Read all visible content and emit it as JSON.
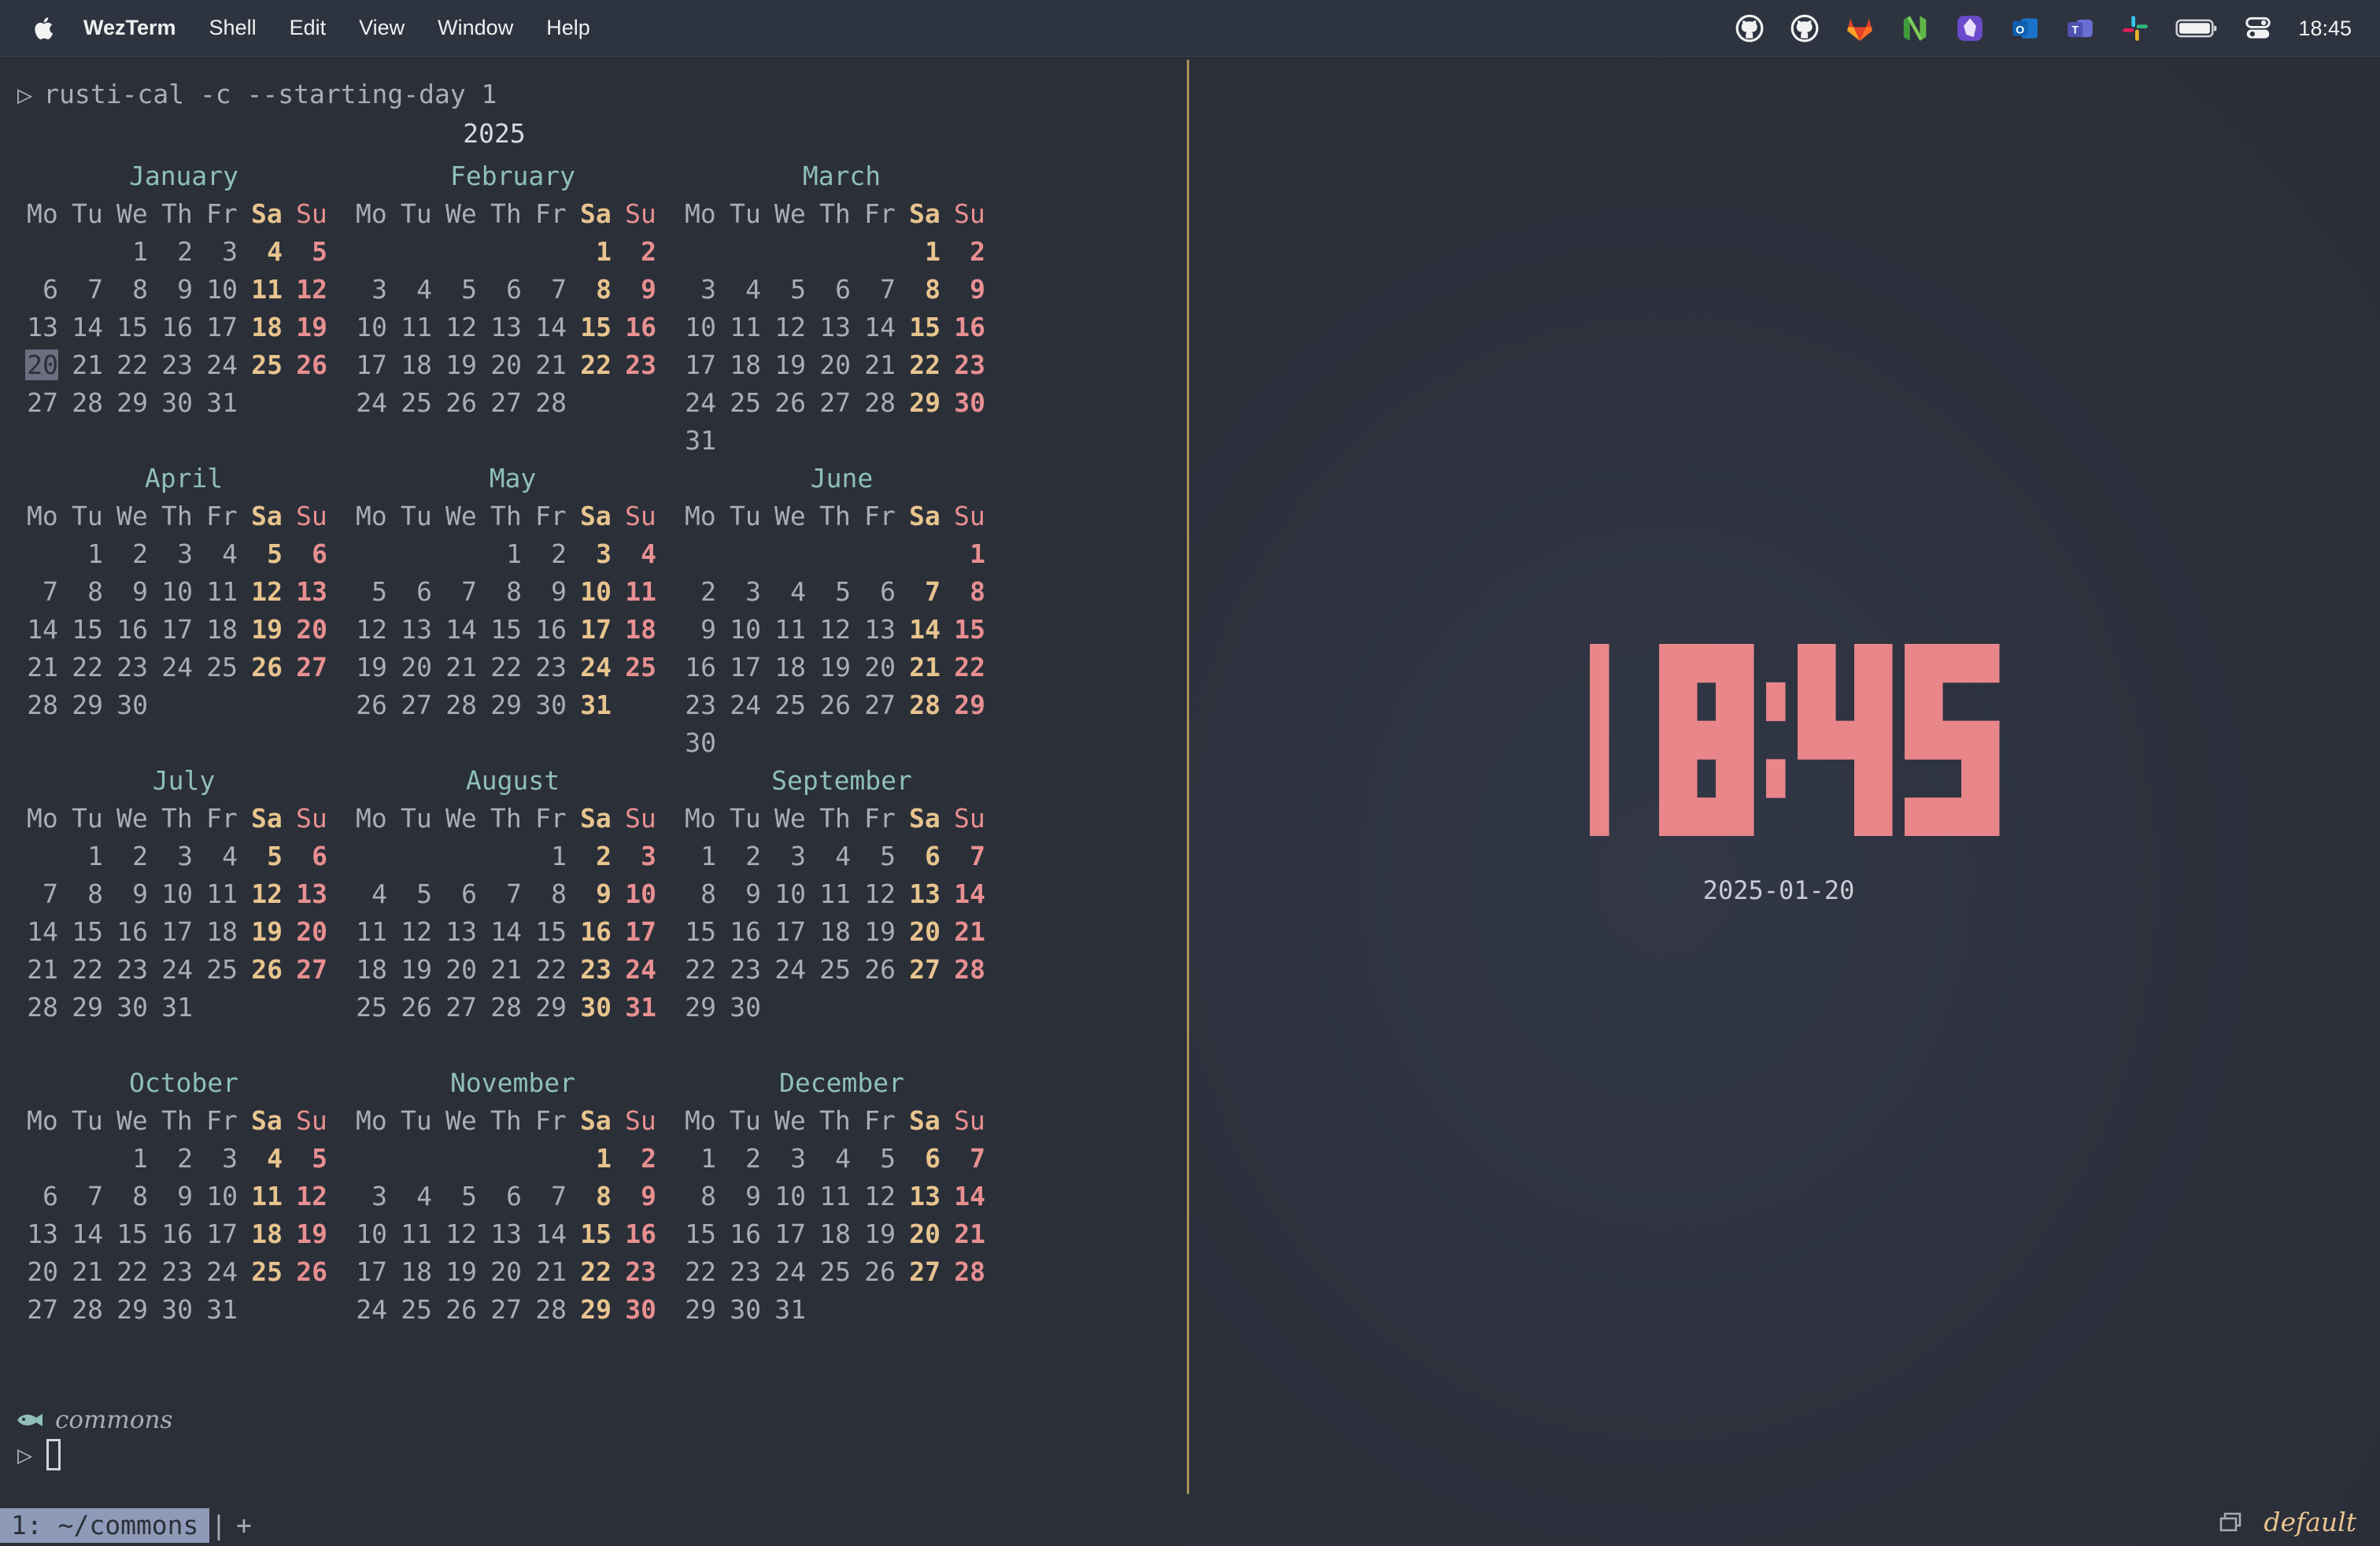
{
  "menubar": {
    "app_name": "WezTerm",
    "menus": [
      "Shell",
      "Edit",
      "View",
      "Window",
      "Help"
    ],
    "tray_icons": [
      "github-icon",
      "github-icon",
      "gitlab-icon",
      "neovim-icon",
      "obsidian-icon",
      "outlook-icon",
      "teams-icon",
      "slack-icon",
      "battery-icon",
      "control-center-icon"
    ],
    "time": "18:45"
  },
  "terminal": {
    "command": "rusti-cal -c --starting-day 1",
    "year": "2025",
    "weekdays": [
      "Mo",
      "Tu",
      "We",
      "Th",
      "Fr",
      "Sa",
      "Su"
    ],
    "today": "2025-01-20",
    "months": [
      {
        "name": "January",
        "offset": 2,
        "days": 31
      },
      {
        "name": "February",
        "offset": 5,
        "days": 28
      },
      {
        "name": "March",
        "offset": 5,
        "days": 31
      },
      {
        "name": "April",
        "offset": 1,
        "days": 30
      },
      {
        "name": "May",
        "offset": 3,
        "days": 31
      },
      {
        "name": "June",
        "offset": 6,
        "days": 30
      },
      {
        "name": "July",
        "offset": 1,
        "days": 31
      },
      {
        "name": "August",
        "offset": 4,
        "days": 31
      },
      {
        "name": "September",
        "offset": 0,
        "days": 30
      },
      {
        "name": "October",
        "offset": 2,
        "days": 31
      },
      {
        "name": "November",
        "offset": 5,
        "days": 30
      },
      {
        "name": "December",
        "offset": 0,
        "days": 31
      }
    ],
    "prompt_dir": "commons",
    "prompt_symbol": "▷"
  },
  "tabbar": {
    "active_tab": "1: ~/commons",
    "separator": "|",
    "add_label": "+",
    "workspace": "default"
  },
  "clock": {
    "time": "18:45",
    "date": "2025-01-20",
    "color": "#e8868a"
  }
}
